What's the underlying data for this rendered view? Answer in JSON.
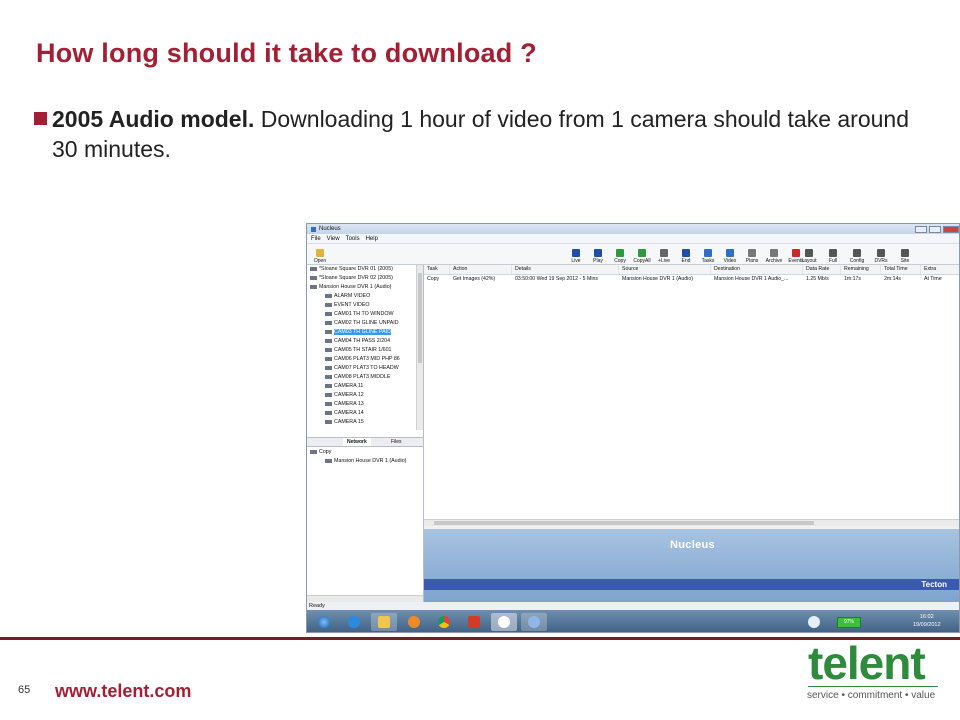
{
  "slide": {
    "title": "How long should it take to download ?",
    "bullet_bold": "2005 Audio model.",
    "bullet_rest": " Downloading 1 hour of video from 1 camera should take around 30 minutes.",
    "page_number": "65",
    "footer_url": "www.telent.com",
    "logo_word": "telent",
    "logo_tagline": "service • commitment • value",
    "colors": {
      "title": "#a31f34",
      "logo_green": "#2e8b3e"
    }
  },
  "app": {
    "window_title": "Nucleus",
    "menu": [
      "File",
      "View",
      "Tools",
      "Help"
    ],
    "toolbar_left": [
      {
        "label": "Open",
        "icon": "open-icon",
        "color": "#e2b53a"
      }
    ],
    "toolbar_mid": [
      {
        "label": "Live",
        "icon": "live-icon",
        "color": "#1f4fa8"
      },
      {
        "label": "Play",
        "icon": "play-icon",
        "color": "#1f4fa8"
      },
      {
        "label": "Copy",
        "icon": "copy-icon",
        "color": "#2e9a3e"
      },
      {
        "label": "CopyAll",
        "icon": "copyall-icon",
        "color": "#2e9a3e"
      },
      {
        "label": "+Live",
        "icon": "addlive-icon",
        "color": "#666666"
      },
      {
        "label": "End",
        "icon": "end-icon",
        "color": "#1f4fa8"
      },
      {
        "label": "Tasks",
        "icon": "tasks-icon",
        "color": "#2e6ec4"
      },
      {
        "label": "Video",
        "icon": "video-icon",
        "color": "#2e6ec4"
      },
      {
        "label": "Plans",
        "icon": "plans-icon",
        "color": "#777777"
      },
      {
        "label": "Archive",
        "icon": "archive-icon",
        "color": "#777777"
      },
      {
        "label": "Events",
        "icon": "events-icon",
        "color": "#c92a2a"
      }
    ],
    "toolbar_right": [
      {
        "label": "Layout",
        "icon": "layout-icon",
        "color": "#555555"
      },
      {
        "label": "Full",
        "icon": "fullscreen-icon",
        "color": "#555555"
      },
      {
        "label": "Config",
        "icon": "config-icon",
        "color": "#555555"
      },
      {
        "label": "DVRs",
        "icon": "dvrs-icon",
        "color": "#555555"
      },
      {
        "label": "Site",
        "icon": "site-icon",
        "color": "#555555"
      }
    ],
    "tree": [
      {
        "label": "*Sloane Square DVR 01 (2005)",
        "level": 0
      },
      {
        "label": "*Sloane Square DVR 02 (2005)",
        "level": 0
      },
      {
        "label": "Mansion House DVR 1 (Audio)",
        "level": 0
      },
      {
        "label": "ALARM VIDEO",
        "level": 1
      },
      {
        "label": "EVENT VIDEO",
        "level": 1
      },
      {
        "label": "CAM01 TH TO WINDOW",
        "level": 1
      },
      {
        "label": "CAM02 TH GLINE UNPAID",
        "level": 1
      },
      {
        "label": "CAM03 TH GLINE PAID",
        "level": 1,
        "selected": true
      },
      {
        "label": "CAM04 TH PASS 2/204",
        "level": 1
      },
      {
        "label": "CAM05 TH STAIR 1/601",
        "level": 1
      },
      {
        "label": "CAM06 PLAT3 MID PHP 86",
        "level": 1
      },
      {
        "label": "CAM07 PLAT3 TO HEADW",
        "level": 1
      },
      {
        "label": "CAM08 PLAT3 MIDDLE",
        "level": 1
      },
      {
        "label": "CAMERA 11",
        "level": 1
      },
      {
        "label": "CAMERA 12",
        "level": 1
      },
      {
        "label": "CAMERA 13",
        "level": 1
      },
      {
        "label": "CAMERA 14",
        "level": 1
      },
      {
        "label": "CAMERA 15",
        "level": 1
      }
    ],
    "tabs": [
      "Network",
      "Files"
    ],
    "lower_tree": [
      {
        "label": "Copy",
        "level": 0
      },
      {
        "label": "Mansion House DVR 1 (Audio)",
        "level": 1
      }
    ],
    "grid_headers": [
      "Task",
      "Action",
      "Details",
      "Source",
      "Destination",
      "Data Rate",
      "Remaining",
      "Total Time",
      "Extra"
    ],
    "grid_rows": [
      [
        "Copy",
        "Get Images (42%)",
        "03:50:00 Wed 19 Sep 2012 - 5 Mins",
        "Mansion House DVR 1 (Audio)",
        "Mansion House DVR 1 Audio_...",
        "1.25 Mb/s",
        "1m:17s",
        "2m:14s",
        "At Time"
      ]
    ],
    "banner_title": "Nucleus",
    "banner_brand": "Tecton",
    "status": "Ready",
    "battery": "97%",
    "clock_time": "16:02",
    "clock_date": "19/09/2012"
  }
}
